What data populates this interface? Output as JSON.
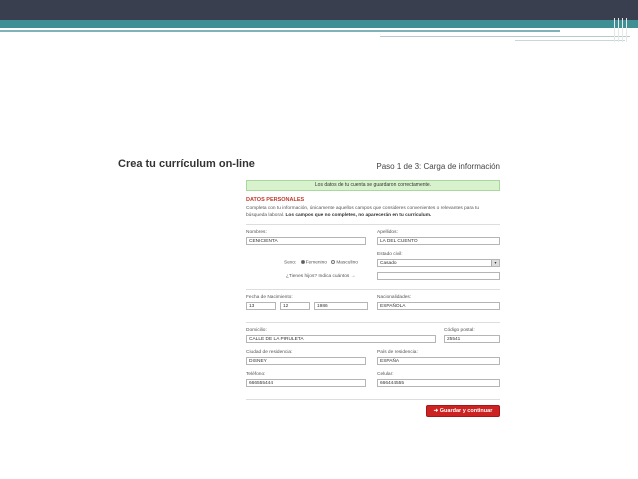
{
  "header": {
    "title": "Crea tu currículum on-line",
    "step": "Paso 1 de 3: Carga de información"
  },
  "notice": "Los datos de tu cuenta se guardaron correctamente.",
  "section": {
    "title": "DATOS PERSONALES",
    "intro": "Completa con tu información, únicamente aquellos campos que consideres convenientes o relevantes para tu búsqueda laboral.",
    "intro_bold": "Los campos que no completes, no aparecerán en tu currículum."
  },
  "fields": {
    "nombres_label": "Nombres:",
    "nombres_value": "CENICIENTA",
    "apellidos_label": "Apellidos:",
    "apellidos_value": "LA DEL CUENTO",
    "sexo_label": "Sexo:",
    "sexo_fem": "Femenino",
    "sexo_masc": "Masculino",
    "estado_label": "Estado civil:",
    "estado_value": "Casado",
    "hijos_label": "¿Tienes hijos? Indica cuántos →",
    "hijos_value": "",
    "fecha_label": "Fecha de Nacimiento:",
    "dia": "13",
    "mes": "12",
    "anio": "1986",
    "nacionalidad_label": "Nacionalidades:",
    "nacionalidad_value": "ESPAÑOLA",
    "domicilio_label": "Domicilio:",
    "domicilio_value": "CALLE DE LA PIRULETA",
    "cp_label": "Código postal:",
    "cp_value": "25541",
    "ciudad_label": "Ciudad de residencia:",
    "ciudad_value": "DISNEY",
    "pais_label": "País de residencia:",
    "pais_value": "ESPAÑA",
    "telefono_label": "Teléfono:",
    "telefono_value": "666555444",
    "celular_label": "Celular:",
    "celular_value": "666444555"
  },
  "actions": {
    "save_label": "Guardar y continuar"
  },
  "colors": {
    "accent": "#cc2222",
    "notice_bg": "#d7f2cc",
    "section": "#c0392b"
  }
}
